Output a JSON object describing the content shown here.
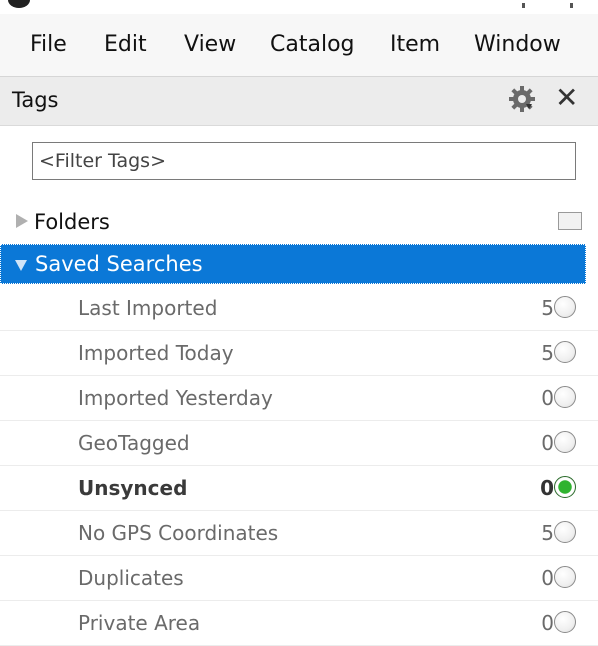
{
  "menu": {
    "items": [
      {
        "label": "File"
      },
      {
        "label": "Edit"
      },
      {
        "label": "View"
      },
      {
        "label": "Catalog"
      },
      {
        "label": "Item"
      },
      {
        "label": "Window"
      }
    ]
  },
  "panel": {
    "title": "Tags",
    "gear_icon": "gear-icon",
    "close_icon": "close-icon",
    "close_glyph": "✕"
  },
  "filter": {
    "placeholder": "<Filter Tags>",
    "value": ""
  },
  "tree": {
    "folders_label": "Folders",
    "saved_searches_label": "Saved Searches",
    "selected_color": "#0b78d7",
    "items": [
      {
        "label": "Last Imported",
        "count": "5",
        "active": false
      },
      {
        "label": "Imported Today",
        "count": "5",
        "active": false
      },
      {
        "label": "Imported Yesterday",
        "count": "0",
        "active": false
      },
      {
        "label": "GeoTagged",
        "count": "0",
        "active": false
      },
      {
        "label": "Unsynced",
        "count": "0",
        "active": true
      },
      {
        "label": "No GPS Coordinates",
        "count": "5",
        "active": false
      },
      {
        "label": "Duplicates",
        "count": "0",
        "active": false
      },
      {
        "label": "Private Area",
        "count": "0",
        "active": false
      }
    ]
  }
}
